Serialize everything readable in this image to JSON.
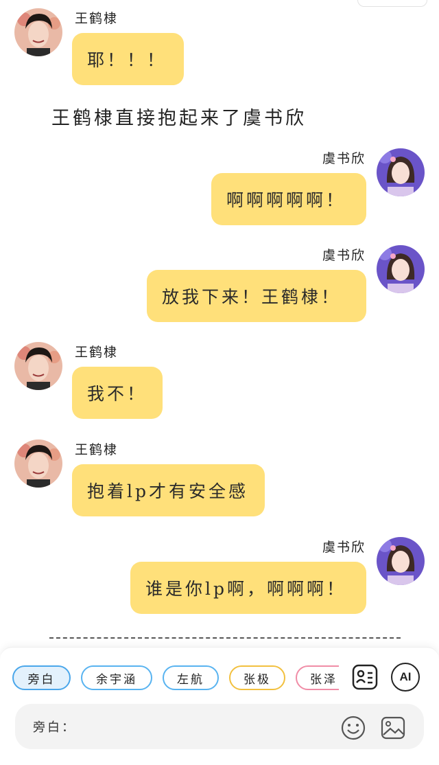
{
  "messages": [
    {
      "side": "left",
      "avatar": "wang-hedi-avatar",
      "name": "王鹤棣",
      "text": "耶！！！"
    },
    {
      "side": "right",
      "avatar": "yu-shuxin-avatar",
      "name": "虞书欣",
      "text": "啊啊啊啊啊！"
    },
    {
      "side": "right",
      "avatar": "yu-shuxin-avatar",
      "name": "虞书欣",
      "text": "放我下来！王鹤棣！"
    },
    {
      "side": "left",
      "avatar": "wang-hedi-avatar",
      "name": "王鹤棣",
      "text": "我不！"
    },
    {
      "side": "left",
      "avatar": "wang-hedi-avatar",
      "name": "王鹤棣",
      "text": "抱着lp才有安全感"
    },
    {
      "side": "right",
      "avatar": "yu-shuxin-avatar",
      "name": "虞书欣",
      "text": "谁是你lp啊，啊啊啊！"
    }
  ],
  "narration": "王鹤棣直接抱起来了虞书欣",
  "roles": [
    {
      "label": "旁白",
      "state": "selected"
    },
    {
      "label": "余宇涵",
      "state": "normal"
    },
    {
      "label": "左航",
      "state": "normal"
    },
    {
      "label": "张极",
      "state": "normal"
    },
    {
      "label": "张泽",
      "state": "normal"
    }
  ],
  "toolbar": {
    "contacts_icon": "contact-card-icon",
    "ai_label": "AI"
  },
  "input": {
    "label": "旁白：",
    "value": "",
    "placeholder": ""
  },
  "icons": {
    "emoji": "emoji-icon",
    "image": "image-icon"
  },
  "colors": {
    "bubble": "#ffe07a",
    "chip_blue": "#58b3f0",
    "chip_orange": "#f2c03e",
    "chip_pink": "#f08ca6"
  }
}
